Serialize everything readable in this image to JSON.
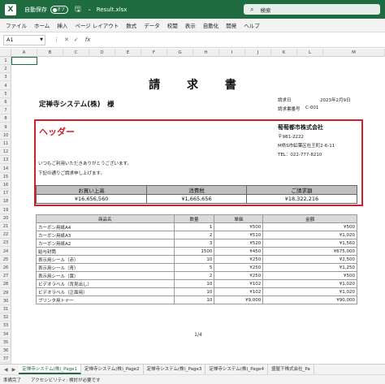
{
  "titlebar": {
    "autosave_label": "自動保存",
    "toggle_state": "オフ",
    "filename": "Result.xlsx",
    "search_placeholder": "検索"
  },
  "menu": [
    "ファイル",
    "ホーム",
    "挿入",
    "ページ レイアウト",
    "数式",
    "データ",
    "校閲",
    "表示",
    "自動化",
    "開発",
    "ヘルプ"
  ],
  "formula": {
    "cell_ref": "A1",
    "fx": "fx"
  },
  "columns": [
    "A",
    "B",
    "C",
    "D",
    "E",
    "F",
    "G",
    "H",
    "I",
    "J",
    "K",
    "L",
    "M"
  ],
  "rows": [
    "1",
    "2",
    "3",
    "4",
    "5",
    "6",
    "7",
    "8",
    "9",
    "10",
    "11",
    "12",
    "13",
    "14",
    "15",
    "16",
    "17",
    "18",
    "19",
    "20",
    "21",
    "22",
    "23",
    "24",
    "25",
    "26",
    "27",
    "28",
    "29",
    "30",
    "31",
    "32",
    "33",
    "34",
    "35",
    "36",
    "37"
  ],
  "document": {
    "title": "請 求 書",
    "client": "定禅寺システム(株)　様",
    "invoice_date_label": "請求日",
    "invoice_date": "2023年2月9日",
    "invoice_no_label": "請求書番号",
    "invoice_no": "C-001",
    "header_label": "ヘッダー",
    "company_name": "萄萄都市株式会社",
    "postal": "〒981-2222",
    "address": "M県S市虹葉区杜王町2-6-11",
    "tel": "TEL：022-777-8210",
    "greeting1": "いつもご利用いただきありがとうございます。",
    "greeting2": "下記の通りご請求申し上げます。",
    "page": "1/4"
  },
  "summary": {
    "headers": [
      "お買い上高",
      "消費税",
      "ご請求額"
    ],
    "values": [
      "¥16,656,560",
      "¥1,665,656",
      "¥18,322,216"
    ]
  },
  "items": {
    "headers": [
      "商品名",
      "数量",
      "単価",
      "金額"
    ],
    "rows": [
      [
        "カーボン用紙A4",
        "1",
        "¥500",
        "¥500"
      ],
      [
        "カーボン用紙A3",
        "2",
        "¥510",
        "¥1,020"
      ],
      [
        "カーボン用紙A2",
        "3",
        "¥520",
        "¥1,560"
      ],
      [
        "給与封筒",
        "1500",
        "¥450",
        "¥675,000"
      ],
      [
        "表示用シール（赤）",
        "10",
        "¥250",
        "¥2,500"
      ],
      [
        "表示用シール（青）",
        "5",
        "¥250",
        "¥1,250"
      ],
      [
        "表示用シール（黄）",
        "2",
        "¥250",
        "¥500"
      ],
      [
        "ビデオラベル（背見出し）",
        "10",
        "¥102",
        "¥1,020"
      ],
      [
        "ビデオラベル（正面用）",
        "10",
        "¥102",
        "¥1,020"
      ],
      [
        "プリンタ用トナー",
        "10",
        "¥9,000",
        "¥90,000"
      ]
    ]
  },
  "tabs": [
    "定禅寺システム(株)_Page1",
    "定禅寺システム(株)_Page2",
    "定禅寺システム(株)_Page3",
    "定禅寺システム(株)_Page4",
    "盛屋下株式会社_Pa"
  ],
  "status": {
    "ready": "準備完了",
    "accessibility": "アクセシビリティ: 検討が必要です"
  },
  "colors": {
    "excel_green": "#1e6c40",
    "accent_red": "#d0202e"
  }
}
